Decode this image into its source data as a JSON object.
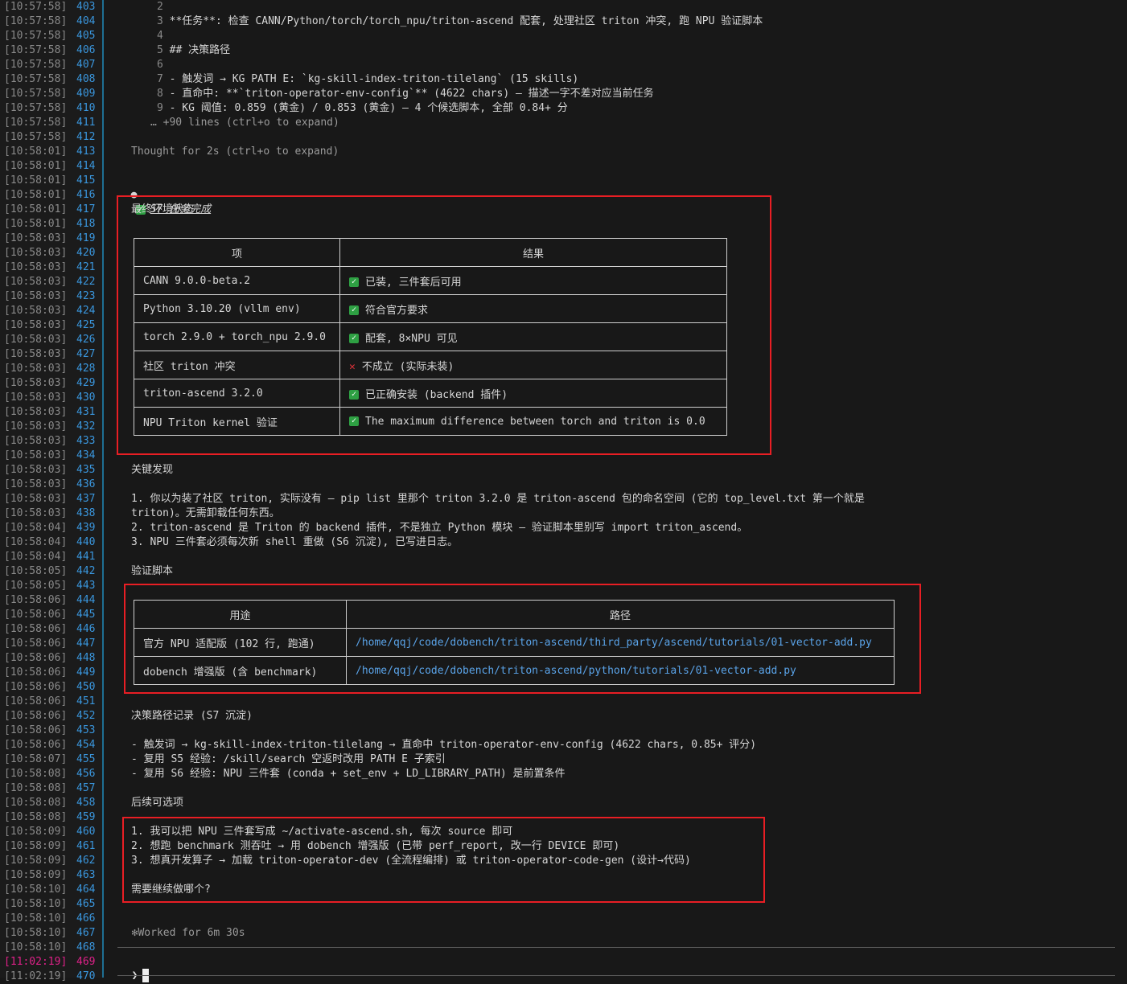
{
  "gutter": [
    {
      "ts": "[10:57:58]",
      "ln": "403"
    },
    {
      "ts": "[10:57:58]",
      "ln": "404"
    },
    {
      "ts": "[10:57:58]",
      "ln": "405"
    },
    {
      "ts": "[10:57:58]",
      "ln": "406"
    },
    {
      "ts": "[10:57:58]",
      "ln": "407"
    },
    {
      "ts": "[10:57:58]",
      "ln": "408"
    },
    {
      "ts": "[10:57:58]",
      "ln": "409"
    },
    {
      "ts": "[10:57:58]",
      "ln": "410"
    },
    {
      "ts": "[10:57:58]",
      "ln": "411"
    },
    {
      "ts": "[10:57:58]",
      "ln": "412"
    },
    {
      "ts": "[10:58:01]",
      "ln": "413"
    },
    {
      "ts": "[10:58:01]",
      "ln": "414"
    },
    {
      "ts": "[10:58:01]",
      "ln": "415"
    },
    {
      "ts": "[10:58:01]",
      "ln": "416"
    },
    {
      "ts": "[10:58:01]",
      "ln": "417"
    },
    {
      "ts": "[10:58:01]",
      "ln": "418"
    },
    {
      "ts": "[10:58:03]",
      "ln": "419"
    },
    {
      "ts": "[10:58:03]",
      "ln": "420"
    },
    {
      "ts": "[10:58:03]",
      "ln": "421"
    },
    {
      "ts": "[10:58:03]",
      "ln": "422"
    },
    {
      "ts": "[10:58:03]",
      "ln": "423"
    },
    {
      "ts": "[10:58:03]",
      "ln": "424"
    },
    {
      "ts": "[10:58:03]",
      "ln": "425"
    },
    {
      "ts": "[10:58:03]",
      "ln": "426"
    },
    {
      "ts": "[10:58:03]",
      "ln": "427"
    },
    {
      "ts": "[10:58:03]",
      "ln": "428"
    },
    {
      "ts": "[10:58:03]",
      "ln": "429"
    },
    {
      "ts": "[10:58:03]",
      "ln": "430"
    },
    {
      "ts": "[10:58:03]",
      "ln": "431"
    },
    {
      "ts": "[10:58:03]",
      "ln": "432"
    },
    {
      "ts": "[10:58:03]",
      "ln": "433"
    },
    {
      "ts": "[10:58:03]",
      "ln": "434"
    },
    {
      "ts": "[10:58:03]",
      "ln": "435"
    },
    {
      "ts": "[10:58:03]",
      "ln": "436"
    },
    {
      "ts": "[10:58:03]",
      "ln": "437"
    },
    {
      "ts": "[10:58:03]",
      "ln": "438"
    },
    {
      "ts": "[10:58:04]",
      "ln": "439"
    },
    {
      "ts": "[10:58:04]",
      "ln": "440"
    },
    {
      "ts": "[10:58:04]",
      "ln": "441"
    },
    {
      "ts": "[10:58:05]",
      "ln": "442"
    },
    {
      "ts": "[10:58:05]",
      "ln": "443"
    },
    {
      "ts": "[10:58:06]",
      "ln": "444"
    },
    {
      "ts": "[10:58:06]",
      "ln": "445"
    },
    {
      "ts": "[10:58:06]",
      "ln": "446"
    },
    {
      "ts": "[10:58:06]",
      "ln": "447"
    },
    {
      "ts": "[10:58:06]",
      "ln": "448"
    },
    {
      "ts": "[10:58:06]",
      "ln": "449"
    },
    {
      "ts": "[10:58:06]",
      "ln": "450"
    },
    {
      "ts": "[10:58:06]",
      "ln": "451"
    },
    {
      "ts": "[10:58:06]",
      "ln": "452"
    },
    {
      "ts": "[10:58:06]",
      "ln": "453"
    },
    {
      "ts": "[10:58:06]",
      "ln": "454"
    },
    {
      "ts": "[10:58:07]",
      "ln": "455"
    },
    {
      "ts": "[10:58:08]",
      "ln": "456"
    },
    {
      "ts": "[10:58:08]",
      "ln": "457"
    },
    {
      "ts": "[10:58:08]",
      "ln": "458"
    },
    {
      "ts": "[10:58:08]",
      "ln": "459"
    },
    {
      "ts": "[10:58:09]",
      "ln": "460"
    },
    {
      "ts": "[10:58:09]",
      "ln": "461"
    },
    {
      "ts": "[10:58:09]",
      "ln": "462"
    },
    {
      "ts": "[10:58:09]",
      "ln": "463"
    },
    {
      "ts": "[10:58:10]",
      "ln": "464"
    },
    {
      "ts": "[10:58:10]",
      "ln": "465"
    },
    {
      "ts": "[10:58:10]",
      "ln": "466"
    },
    {
      "ts": "[10:58:10]",
      "ln": "467"
    },
    {
      "ts": "[10:58:10]",
      "ln": "468"
    },
    {
      "ts": "[11:02:19]",
      "ln": "469"
    },
    {
      "ts": "[11:02:19]",
      "ln": "470"
    }
  ],
  "colors": {
    "accent_red": "#e81e24",
    "gutter_sep": "#1e6f93",
    "line_num": "#3a96dd",
    "current_line": "#e0218a",
    "check_green": "#2ea043",
    "link_blue": "#5aa3e8",
    "num_purple": "#b48ead"
  },
  "file_preview": {
    "l2": {
      "n": "2"
    },
    "l3": {
      "n": "3",
      "text": "**任务**: 检查 CANN/Python/torch/torch_npu/triton-ascend 配套, 处理社区 triton 冲突, 跑 NPU 验证脚本"
    },
    "l4": {
      "n": "4"
    },
    "l5": {
      "n": "5",
      "text": "## 决策路径"
    },
    "l6": {
      "n": "6"
    },
    "l7": {
      "n": "7",
      "text": "- 触发词 → KG PATH E: `kg-skill-index-triton-tilelang` (15 skills)"
    },
    "l8": {
      "n": "8",
      "text": "- 直命中: **`triton-operator-env-config`** (4622 chars) — 描述一字不差对应当前任务"
    },
    "l9": {
      "n": "9",
      "text": "- KG 阈值: 0.859 (黄金) / 0.853 (黄金) — 4 个候选脚本, 全部 0.84+ 分"
    },
    "more": "… +90 lines (ctrl+o to expand)"
  },
  "thought": "Thought for 2s (ctrl+o to expand)",
  "task_done": {
    "icon": "check-icon",
    "text": "S7 任务完成"
  },
  "env_section": {
    "title": "最终环境状态",
    "headers": [
      "项",
      "结果"
    ],
    "rows": [
      {
        "item": "CANN 9.0.0-beta.2",
        "status": "check",
        "result": "已装, 三件套后可用"
      },
      {
        "item": "Python 3.10.20 (vllm env)",
        "status": "check",
        "result": "符合官方要求"
      },
      {
        "item": "torch 2.9.0 + torch_npu 2.9.0",
        "status": "check",
        "result": "配套, 8×NPU 可见"
      },
      {
        "item": "社区 triton 冲突",
        "status": "cross",
        "result": "不成立 (实际未装)"
      },
      {
        "item": "triton-ascend 3.2.0",
        "status": "check",
        "result": "已正确安装 (backend 插件)"
      },
      {
        "item": "NPU Triton kernel 验证",
        "status": "check",
        "result": "The maximum difference between torch and triton is 0.0"
      }
    ]
  },
  "findings": {
    "title": "关键发现",
    "l1a": "1. 你以为装了社区 triton, 实际没有 — pip list 里那个 triton 3.2.0 是 triton-ascend 包的命名空间 (它的 top_level.txt 第一个就是",
    "l1b": "triton)。无需卸载任何东西。",
    "l2": "2. triton-ascend 是 Triton 的 backend 插件, 不是独立 Python 模块 — 验证脚本里别写 import triton_ascend。",
    "l3": "3. NPU 三件套必须每次新 shell 重做 (S6 沉淀), 已写进日志。"
  },
  "scripts_section": {
    "title": "验证脚本",
    "headers": [
      "用途",
      "路径"
    ],
    "rows": [
      {
        "use": "官方 NPU 适配版 (102 行, 跑通)",
        "path": "/home/qqj/code/dobench/triton-ascend/third_party/ascend/tutorials/01-vector-add.py"
      },
      {
        "use": "dobench 增强版 (含 benchmark)",
        "path": "/home/qqj/code/dobench/triton-ascend/python/tutorials/01-vector-add.py"
      }
    ]
  },
  "decision_log": {
    "title": "决策路径记录 (S7 沉淀)",
    "l1": "- 触发词 → kg-skill-index-triton-tilelang → 直命中 triton-operator-env-config (4622 chars, 0.85+ 评分)",
    "l2": "- 复用 S5 经验: /skill/search 空返时改用 PATH E 子索引",
    "l3": "- 复用 S6 经验: NPU 三件套 (conda + set_env + LD_LIBRARY_PATH) 是前置条件"
  },
  "next_steps": {
    "title": "后续可选项",
    "l1": "1. 我可以把 NPU 三件套写成 ~/activate-ascend.sh, 每次 source 即可",
    "l2": "2. 想跑 benchmark 测吞吐 → 用 dobench 增强版 (已带 perf_report, 改一行 DEVICE 即可)",
    "l3": "3. 想真开发算子 → 加载 triton-operator-dev (全流程编排) 或 triton-operator-code-gen (设计→代码)",
    "question": "需要继续做哪个?"
  },
  "worked": {
    "icon": "asterisk-icon",
    "text": "Worked for 6m 30s"
  },
  "prompt": {
    "symbol": "❯",
    "value": ""
  }
}
